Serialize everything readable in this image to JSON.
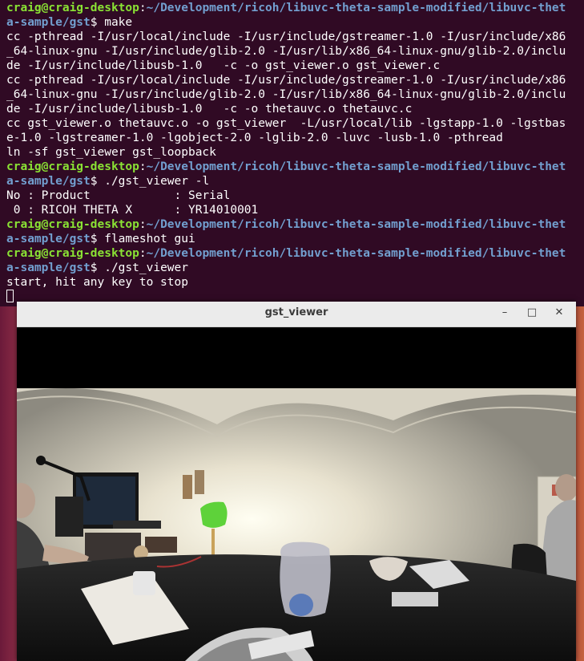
{
  "terminal": {
    "lines": [
      {
        "user": "craig@craig-desktop",
        "sep": ":",
        "path": "~/Development/ricoh/libuvc-theta-sample-modified/libuvc-thet"
      },
      {
        "path": "a-sample/gst",
        "cmd": "$ make"
      },
      {
        "text": "cc -pthread -I/usr/local/include -I/usr/include/gstreamer-1.0 -I/usr/include/x86"
      },
      {
        "text": "_64-linux-gnu -I/usr/include/glib-2.0 -I/usr/lib/x86_64-linux-gnu/glib-2.0/inclu"
      },
      {
        "text": "de -I/usr/include/libusb-1.0   -c -o gst_viewer.o gst_viewer.c"
      },
      {
        "text": "cc -pthread -I/usr/local/include -I/usr/include/gstreamer-1.0 -I/usr/include/x86"
      },
      {
        "text": "_64-linux-gnu -I/usr/include/glib-2.0 -I/usr/lib/x86_64-linux-gnu/glib-2.0/inclu"
      },
      {
        "text": "de -I/usr/include/libusb-1.0   -c -o thetauvc.o thetauvc.c"
      },
      {
        "text": "cc gst_viewer.o thetauvc.o -o gst_viewer  -L/usr/local/lib -lgstapp-1.0 -lgstbas"
      },
      {
        "text": "e-1.0 -lgstreamer-1.0 -lgobject-2.0 -lglib-2.0 -luvc -lusb-1.0 -pthread"
      },
      {
        "text": "ln -sf gst_viewer gst_loopback"
      },
      {
        "user": "craig@craig-desktop",
        "sep": ":",
        "path": "~/Development/ricoh/libuvc-theta-sample-modified/libuvc-thet"
      },
      {
        "path": "a-sample/gst",
        "cmd": "$ ./gst_viewer -l"
      },
      {
        "text": "No : Product            : Serial"
      },
      {
        "text": " 0 : RICOH THETA X      : YR14010001"
      },
      {
        "user": "craig@craig-desktop",
        "sep": ":",
        "path": "~/Development/ricoh/libuvc-theta-sample-modified/libuvc-thet"
      },
      {
        "path": "a-sample/gst",
        "cmd": "$ flameshot gui"
      },
      {
        "user": "craig@craig-desktop",
        "sep": ":",
        "path": "~/Development/ricoh/libuvc-theta-sample-modified/libuvc-thet"
      },
      {
        "path": "a-sample/gst",
        "cmd": "$ ./gst_viewer"
      },
      {
        "text": "start, hit any key to stop"
      }
    ]
  },
  "viewer": {
    "title": "gst_viewer",
    "minimize_icon": "minimize-icon",
    "maximize_icon": "maximize-icon",
    "close_icon": "close-icon",
    "minimize_glyph": "–",
    "maximize_glyph": "□",
    "close_glyph": "✕"
  },
  "colors": {
    "terminal_bg": "#300a24",
    "prompt_user": "#8ae234",
    "prompt_path": "#729fcf"
  }
}
